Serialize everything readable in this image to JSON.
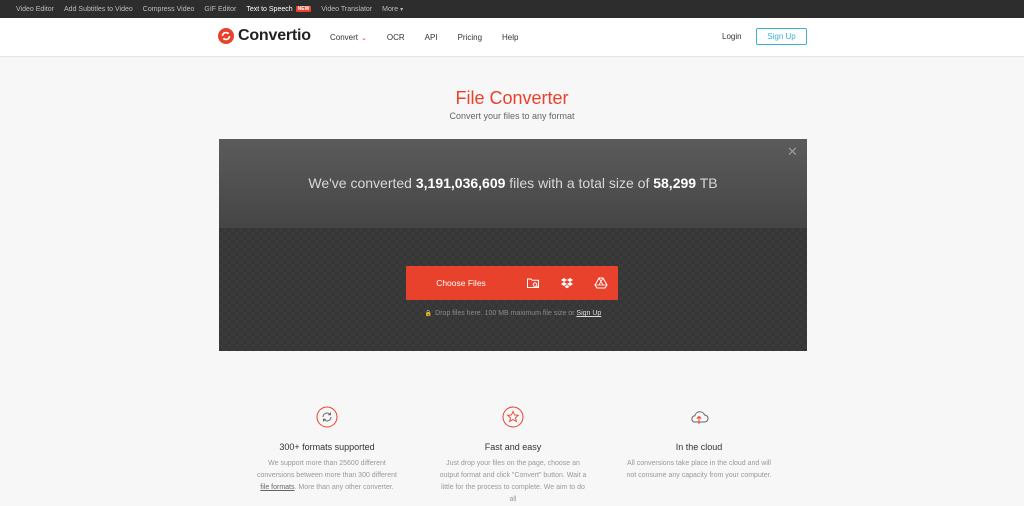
{
  "topbar": {
    "links": [
      "Video Editor",
      "Add Subtitles to Video",
      "Compress Video",
      "GIF Editor",
      "Text to Speech",
      "Video Translator",
      "More"
    ],
    "new_badge": "NEW"
  },
  "header": {
    "logo_text": "Convertio",
    "nav": [
      "Convert",
      "OCR",
      "API",
      "Pricing",
      "Help"
    ],
    "login": "Login",
    "signup": "Sign Up"
  },
  "hero": {
    "title": "File Converter",
    "subtitle": "Convert your files to any format"
  },
  "converter": {
    "stats_prefix": "We've converted",
    "files_count": "3,191,036,609",
    "stats_middle": "files with a total size of",
    "total_size": "58,299",
    "size_unit": "TB",
    "choose_files": "Choose Files",
    "drop_note": "Drop files here. 100 MB maximum file size or",
    "drop_signup": "Sign Up"
  },
  "features": [
    {
      "title": "300+ formats supported",
      "text_before": "We support more than 25600 different conversions between more than 300 different",
      "link": "file formats",
      "text_after": ". More than any other converter."
    },
    {
      "title": "Fast and easy",
      "text_before": "Just drop your files on the page, choose an output format and click \"Convert\" button. Wait a little for the process to complete. We aim to do all",
      "link": "",
      "text_after": ""
    },
    {
      "title": "In the cloud",
      "text_before": "All conversions take place in the cloud and will not consume any capacity from your computer.",
      "link": "",
      "text_after": ""
    }
  ],
  "colors": {
    "accent": "#e8412c",
    "signup": "#3bb2d0",
    "topbar": "#2d2d2d"
  }
}
